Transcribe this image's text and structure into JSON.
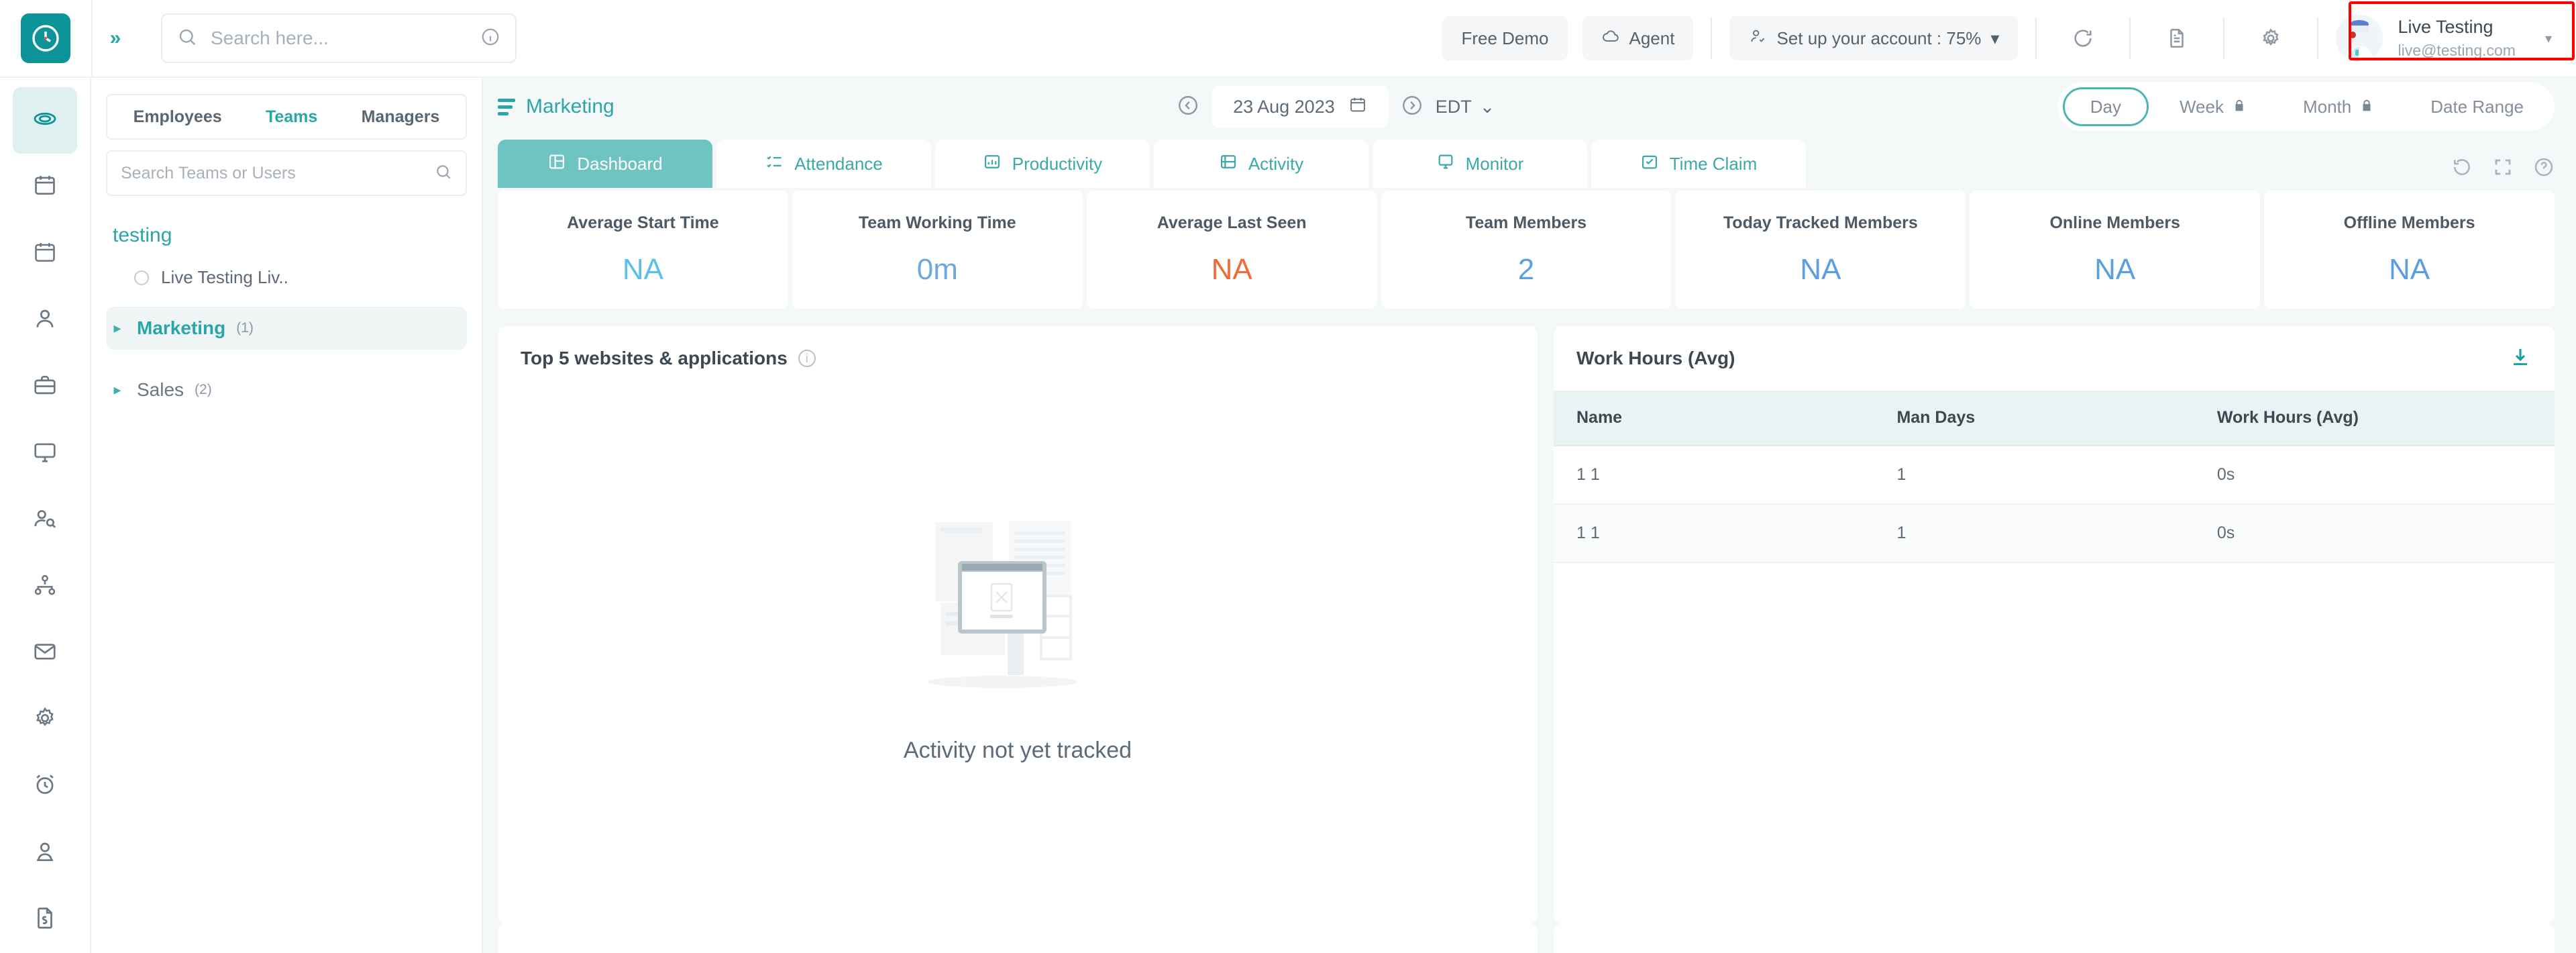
{
  "topbar": {
    "logo_icon": "clock-icon",
    "collapse_icon": "chevron-double-right-icon",
    "search": {
      "placeholder": "Search here...",
      "value": "",
      "icon": "search-icon",
      "info_icon": "info-icon"
    },
    "free_demo_label": "Free Demo",
    "agent_label": "Agent",
    "agent_icon": "cloud-icon",
    "setup_label": "Set up your account : 75%",
    "setup_icon": "person-check-icon",
    "setup_caret": "▾",
    "icons": [
      "refresh-icon",
      "document-icon",
      "gear-icon"
    ],
    "user": {
      "name": "Live Testing",
      "email": "live@testing.com",
      "caret": "▾"
    },
    "highlight_color": "#ff0000"
  },
  "rail": {
    "items": [
      {
        "name": "dashboard",
        "icon": "dashboard-icon",
        "active": true
      },
      {
        "name": "calendar",
        "icon": "calendar-icon",
        "active": false
      },
      {
        "name": "timesheet",
        "icon": "calendar-grid-icon",
        "active": false
      },
      {
        "name": "people",
        "icon": "person-icon",
        "active": false
      },
      {
        "name": "projects",
        "icon": "briefcase-icon",
        "active": false
      },
      {
        "name": "monitor",
        "icon": "monitor-icon",
        "active": false
      },
      {
        "name": "team-search",
        "icon": "people-search-icon",
        "active": false
      },
      {
        "name": "org-chart",
        "icon": "org-chart-icon",
        "active": false
      },
      {
        "name": "mail",
        "icon": "mail-icon",
        "active": false
      },
      {
        "name": "settings",
        "icon": "gear-icon",
        "active": false
      },
      {
        "name": "alarm",
        "icon": "alarm-clock-icon",
        "active": false
      },
      {
        "name": "profile",
        "icon": "person-badge-icon",
        "active": false
      },
      {
        "name": "reports",
        "icon": "file-icon",
        "active": false
      }
    ]
  },
  "teams_panel": {
    "tabs": [
      {
        "label": "Employees",
        "active": false
      },
      {
        "label": "Teams",
        "active": true
      },
      {
        "label": "Managers",
        "active": false
      }
    ],
    "search": {
      "placeholder": "Search Teams or Users",
      "value": "",
      "icon": "search-icon"
    },
    "root": "testing",
    "user": {
      "label": "Live Testing Liv..",
      "status_icon": "status-dot-icon"
    },
    "teams": [
      {
        "name": "Marketing",
        "count": "(1)",
        "active": true,
        "arrow": "▸"
      },
      {
        "name": "Sales",
        "count": "(2)",
        "active": false,
        "arrow": "▸"
      }
    ]
  },
  "main": {
    "context_title": "Marketing",
    "menu_icon": "hamburger-icon",
    "prev_icon": "chevron-left-circle-icon",
    "date": "23 Aug 2023",
    "calendar_icon": "calendar-icon",
    "next_icon": "chevron-right-circle-icon",
    "timezone": "EDT",
    "timezone_caret": "⌄",
    "ranges": [
      {
        "label": "Day",
        "active": true,
        "locked": false
      },
      {
        "label": "Week",
        "active": false,
        "locked": true
      },
      {
        "label": "Month",
        "active": false,
        "locked": true
      },
      {
        "label": "Date Range",
        "active": false,
        "locked": false
      }
    ],
    "tabs": [
      {
        "label": "Dashboard",
        "icon": "dashboard-tab-icon",
        "active": true
      },
      {
        "label": "Attendance",
        "icon": "attendance-icon",
        "active": false
      },
      {
        "label": "Productivity",
        "icon": "productivity-icon",
        "active": false
      },
      {
        "label": "Activity",
        "icon": "activity-icon",
        "active": false
      },
      {
        "label": "Monitor",
        "icon": "monitor-tab-icon",
        "active": false
      },
      {
        "label": "Time Claim",
        "icon": "time-claim-icon",
        "active": false
      }
    ],
    "tab_tools": [
      "refresh-icon",
      "fullscreen-icon",
      "help-icon"
    ],
    "kpis": [
      {
        "label": "Average Start Time",
        "value": "NA",
        "color": "#5bc0e8"
      },
      {
        "label": "Team Working Time",
        "value": "0m",
        "color": "#6fa8dc"
      },
      {
        "label": "Average Last Seen",
        "value": "NA",
        "color": "#ef6c3a"
      },
      {
        "label": "Team Members",
        "value": "2",
        "color": "#5a9fe0"
      },
      {
        "label": "Today Tracked Members",
        "value": "NA",
        "color": "#5a9fe0"
      },
      {
        "label": "Online Members",
        "value": "NA",
        "color": "#5a9fe0"
      },
      {
        "label": "Offline Members",
        "value": "NA",
        "color": "#5a9fe0"
      }
    ],
    "websites_panel": {
      "title": "Top 5 websites & applications",
      "info_icon": "info-icon",
      "empty_illustration": "no-data-monitor-illustration",
      "empty_text": "Activity not yet tracked"
    },
    "work_hours_panel": {
      "title": "Work Hours (Avg)",
      "download_icon": "download-icon",
      "columns": [
        "Name",
        "Man Days",
        "Work Hours (Avg)"
      ],
      "rows": [
        [
          "1 1",
          "1",
          "0s"
        ],
        [
          "1 1",
          "1",
          "0s"
        ]
      ]
    }
  },
  "theme": {
    "teal": "#0d9499",
    "teal_light": "#6ec4c1",
    "bg": "#f4f8f9",
    "text": "#5d6b78"
  }
}
